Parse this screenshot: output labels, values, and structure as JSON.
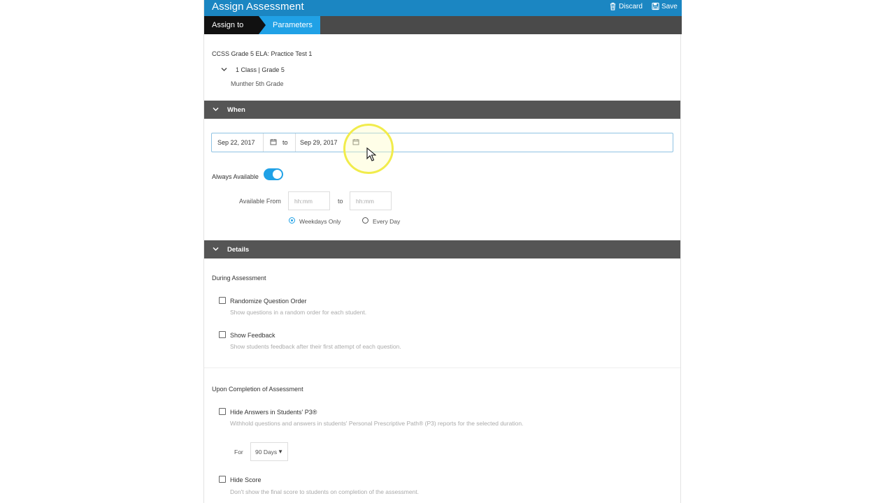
{
  "header": {
    "title": "Assign Assessment",
    "discard_label": "Discard",
    "save_label": "Save"
  },
  "steps": {
    "assign_to": "Assign to",
    "parameters": "Parameters"
  },
  "assessment": {
    "name": "CCSS Grade 5 ELA: Practice Test 1",
    "class_summary": "1 Class | Grade 5",
    "class_name": "Munther 5th Grade"
  },
  "when": {
    "section_label": "When",
    "start_date": "Sep 22, 2017",
    "range_to": "to",
    "end_date": "Sep 29, 2017",
    "always_available_label": "Always Available",
    "always_available": true,
    "available_from_label": "Available From",
    "time_from_placeholder": "hh:mm",
    "time_to": "to",
    "time_to_placeholder": "hh:mm",
    "weekdays_only_label": "Weekdays Only",
    "every_day_label": "Every Day",
    "selected_schedule": "Weekdays Only"
  },
  "details": {
    "section_label": "Details",
    "during_heading": "During Assessment",
    "randomize_label": "Randomize Question Order",
    "randomize_help": "Show questions in a random order for each student.",
    "show_feedback_label": "Show Feedback",
    "show_feedback_help": "Show students feedback after their first attempt of each question.",
    "completion_heading": "Upon Completion of Assessment",
    "hide_answers_label": "Hide Answers in Students' P3®",
    "hide_answers_help": "Withhold questions and answers in students' Personal Prescriptive Path® (P3) reports for the selected duration.",
    "for_label": "For",
    "duration_value": "90 Days",
    "hide_score_label": "Hide Score",
    "hide_score_help": "Don't show the final score to students on completion of the assessment."
  },
  "colors": {
    "header_blue": "#1b86c2",
    "active_step": "#20a1e6",
    "section_bar": "#555555"
  }
}
